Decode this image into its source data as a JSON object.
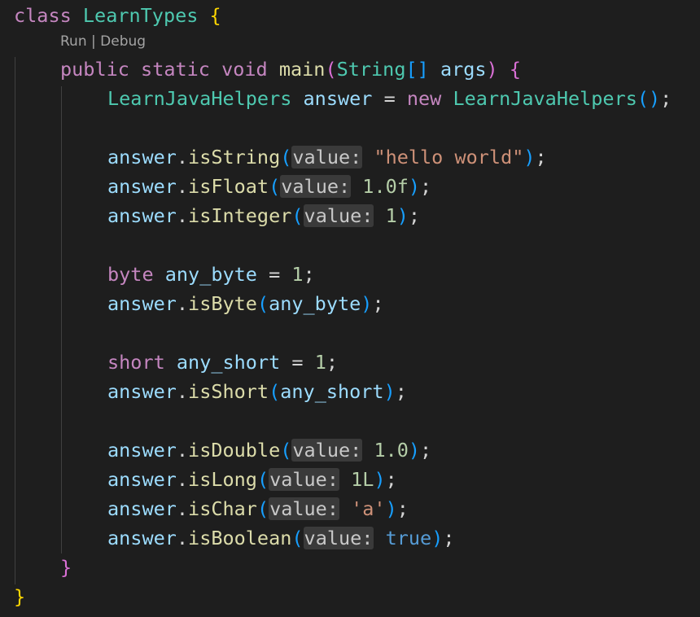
{
  "code_lens": {
    "run": "Run",
    "separator": " | ",
    "debug": "Debug"
  },
  "code": {
    "l1": {
      "kw": "class",
      "name": "LearnTypes",
      "brace": "{"
    },
    "l2": {
      "kw1": "public",
      "kw2": "static",
      "kw3": "void",
      "fn": "main",
      "open": "(",
      "type": "String",
      "arr": "[]",
      "param": "args",
      "close": ")",
      "brace": "{"
    },
    "l3": {
      "type": "LearnJavaHelpers",
      "var": "answer",
      "eq": "=",
      "kw": "new",
      "ctor": "LearnJavaHelpers",
      "parens": "()",
      "semi": ";"
    },
    "l4": {
      "obj": "answer",
      "dot": ".",
      "method": "isString",
      "open": "(",
      "hint": "value:",
      "arg": "\"hello world\"",
      "close": ")",
      "semi": ";"
    },
    "l5": {
      "obj": "answer",
      "dot": ".",
      "method": "isFloat",
      "open": "(",
      "hint": "value:",
      "arg": "1.0f",
      "close": ")",
      "semi": ";"
    },
    "l6": {
      "obj": "answer",
      "dot": ".",
      "method": "isInteger",
      "open": "(",
      "hint": "value:",
      "arg": "1",
      "close": ")",
      "semi": ";"
    },
    "l7": {
      "kw": "byte",
      "var": "any_byte",
      "eq": "=",
      "val": "1",
      "semi": ";"
    },
    "l8": {
      "obj": "answer",
      "dot": ".",
      "method": "isByte",
      "open": "(",
      "arg": "any_byte",
      "close": ")",
      "semi": ";"
    },
    "l9": {
      "kw": "short",
      "var": "any_short",
      "eq": "=",
      "val": "1",
      "semi": ";"
    },
    "l10": {
      "obj": "answer",
      "dot": ".",
      "method": "isShort",
      "open": "(",
      "arg": "any_short",
      "close": ")",
      "semi": ";"
    },
    "l11": {
      "obj": "answer",
      "dot": ".",
      "method": "isDouble",
      "open": "(",
      "hint": "value:",
      "arg": "1.0",
      "close": ")",
      "semi": ";"
    },
    "l12": {
      "obj": "answer",
      "dot": ".",
      "method": "isLong",
      "open": "(",
      "hint": "value:",
      "arg": "1L",
      "close": ")",
      "semi": ";"
    },
    "l13": {
      "obj": "answer",
      "dot": ".",
      "method": "isChar",
      "open": "(",
      "hint": "value:",
      "arg": "'a'",
      "close": ")",
      "semi": ";"
    },
    "l14": {
      "obj": "answer",
      "dot": ".",
      "method": "isBoolean",
      "open": "(",
      "hint": "value:",
      "arg": "true",
      "close": ")",
      "semi": ";"
    },
    "l15": {
      "brace": "}"
    },
    "l16": {
      "brace": "}"
    }
  },
  "colors": {
    "background": "#1e1e1e",
    "keyword": "#c586c0",
    "type": "#4ec9b0",
    "function": "#dcdcaa",
    "variable": "#9cdcfe",
    "string": "#ce9178",
    "number": "#b5cea8",
    "boolean": "#569cd6",
    "brace": "#ffd700",
    "bracket_level2": "#da70d6",
    "bracket_level3": "#179fff",
    "inlay_hint_bg": "#3a3a3a"
  }
}
